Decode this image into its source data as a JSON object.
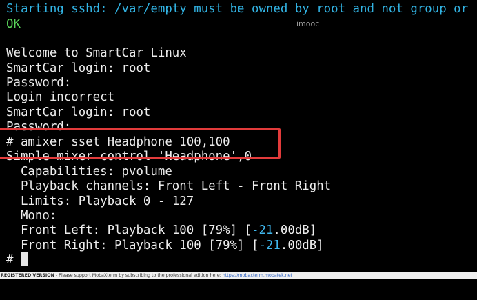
{
  "terminal": {
    "line0": "Starting sshd: /var/empty must be owned by root and not group or",
    "line1": "OK",
    "line3": "Welcome to SmartCar Linux",
    "line4": "SmartCar login: root",
    "line5": "Password:",
    "line6": "Login incorrect",
    "line7": "SmartCar login: root",
    "line8": "Password:",
    "line9": "# amixer sset Headphone 100,100",
    "line10": "Simple mixer control 'Headphone',0",
    "line11": "  Capabilities: pvolume",
    "line12": "  Playback channels: Front Left - Front Right",
    "line13": "  Limits: Playback 0 - 127",
    "line14": "  Mono:",
    "line15_prefix": "  Front Left: Playback 100 [79%] [",
    "line15_num": "-21",
    "line15_suffix": ".00dB]",
    "line16_prefix": "  Front Right: Playback 100 [79%] [",
    "line16_num": "-21",
    "line16_suffix": ".00dB]",
    "prompt": "#"
  },
  "watermark": "imooc",
  "statusbar": {
    "registered": "REGISTERED VERSION",
    "message": " - Please support MobaXterm by subscribing to the professional edition here: ",
    "link": "https://mobaxterm.mobatek.net"
  },
  "colors": {
    "background": "#000000",
    "text": "#ececec",
    "cyan": "#32b3e3",
    "green": "#59d35a",
    "highlight": "#e23b3b"
  }
}
